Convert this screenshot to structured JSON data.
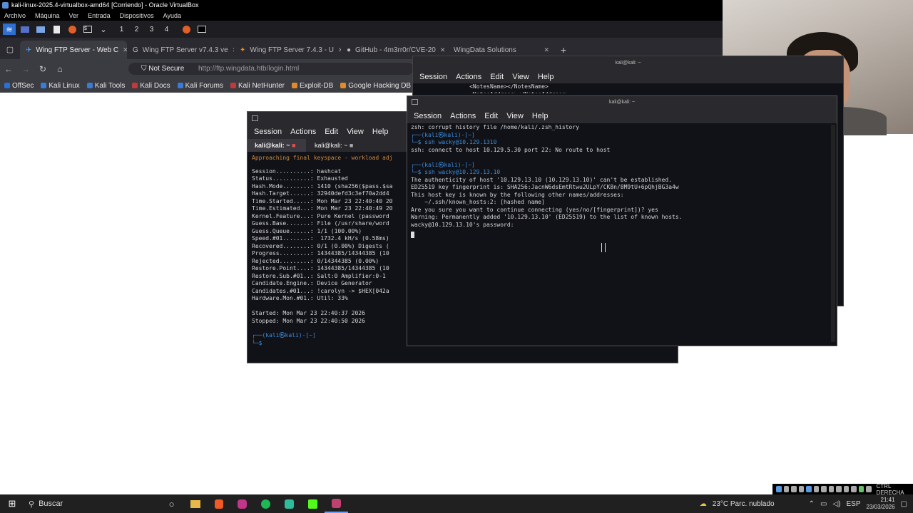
{
  "vbox": {
    "title": "kali-linux-2025.4-virtualbox-amd64 [Corriendo] - Oracle VirtualBox",
    "menu": [
      "Archivo",
      "Máquina",
      "Ver",
      "Entrada",
      "Dispositivos",
      "Ayuda"
    ]
  },
  "panel": {
    "workspaces": [
      "1",
      "2",
      "3",
      "4"
    ]
  },
  "browser": {
    "tabs": [
      {
        "label": "Wing FTP Server - Web C",
        "active": true
      },
      {
        "label": "Wing FTP Server v7.4.3 ve",
        "active": false
      },
      {
        "label": "Wing FTP Server 7.4.3 - U",
        "active": false
      },
      {
        "label": "GitHub - 4m3rr0r/CVE-20",
        "active": false
      },
      {
        "label": "WingData Solutions",
        "active": false
      }
    ],
    "not_secure": "Not Secure",
    "url": "http://ftp.wingdata.htb/login.html",
    "bookmarks": [
      {
        "label": "OffSec",
        "color": "#2a6fd6"
      },
      {
        "label": "Kali Linux",
        "color": "#3a7bd5"
      },
      {
        "label": "Kali Tools",
        "color": "#3a7bd5"
      },
      {
        "label": "Kali Docs",
        "color": "#c03a3a"
      },
      {
        "label": "Kali Forums",
        "color": "#3a7bd5"
      },
      {
        "label": "Kali NetHunter",
        "color": "#c03a3a"
      },
      {
        "label": "Exploit-DB",
        "color": "#e08a2a"
      },
      {
        "label": "Google Hacking DB",
        "color": "#e08a2a"
      }
    ]
  },
  "term_back": {
    "title": "kali@kali: ~",
    "menu": [
      "Session",
      "Actions",
      "Edit",
      "View",
      "Help"
    ],
    "lines": "                <NotesName></NotesName>\n                <NotesAddress></NotesAddress>"
  },
  "term_hashcat": {
    "menu": [
      "Session",
      "Actions",
      "Edit",
      "View",
      "Help"
    ],
    "tab1": "kali@kali: ~",
    "tab2": "kali@kali: ~",
    "warn": "Approaching final keyspace - workload adj",
    "lines": "Session..........: hashcat\nStatus...........: Exhausted\nHash.Mode........: 1410 (sha256($pass.$sa\nHash.Target......: 32940defd3c3ef70a2dd4\nTime.Started.....: Mon Mar 23 22:40:40 20\nTime.Estimated...: Mon Mar 23 22:40:49 20\nKernel.Feature...: Pure Kernel (password\nGuess.Base.......: File (/usr/share/word\nGuess.Queue......: 1/1 (100.00%)\nSpeed.#01........:  1732.4 kH/s (0.58ms)\nRecovered........: 0/1 (0.00%) Digests (\nProgress.........: 14344385/14344385 (10\nRejected.........: 0/14344385 (0.00%)\nRestore.Point....: 14344385/14344385 (10\nRestore.Sub.#01..: Salt:0 Amplifier:0-1\nCandidate.Engine.: Device Generator\nCandidates.#01...: !carolyn -> $HEX[042a\nHardware.Mon.#01.: Util: 33%\n\nStarted: Mon Mar 23 22:40:37 2026\nStopped: Mon Mar 23 22:40:50 2026",
    "prompt1": "┌──(kali㉿kali)-[~]",
    "prompt2": "└─$"
  },
  "term_front": {
    "title": "kali@kali: ~",
    "menu": [
      "Session",
      "Actions",
      "Edit",
      "View",
      "Help"
    ],
    "line1": "zsh: corrupt history file /home/kali/.zsh_history",
    "p1a": "┌──(kali㉿kali)-[~]",
    "p1b": "└─$ ssh wacky@10.129.1310",
    "line2": "ssh: connect to host 10.129.5.30 port 22: No route to host",
    "p2a": "┌──(kali㉿kali)-[~]",
    "p2b": "└─$ ssh wacky@10.129.13.10",
    "out": "The authenticity of host '10.129.13.10 (10.129.13.10)' can't be established.\nED25519 key fingerprint is: SHA256:JacnW6dsEmtRtwu2ULpY/CK8n/8M9tU+6pQhjBG3a4w\nThis host key is known by the following other names/addresses:\n    ~/.ssh/known_hosts:2: [hashed name]\nAre you sure you want to continue connecting (yes/no/[fingerprint])? yes\nWarning: Permanently added '10.129.13.10' (ED25519) to the list of known hosts.\nwacky@10.129.13.10's password:"
  },
  "taskbar": {
    "search": "Buscar",
    "weather": "23°C  Parc. nublado",
    "lang": "ESP",
    "time": "21:41",
    "date": "23/03/2026",
    "ctrl": "CTRL DERECHA"
  }
}
